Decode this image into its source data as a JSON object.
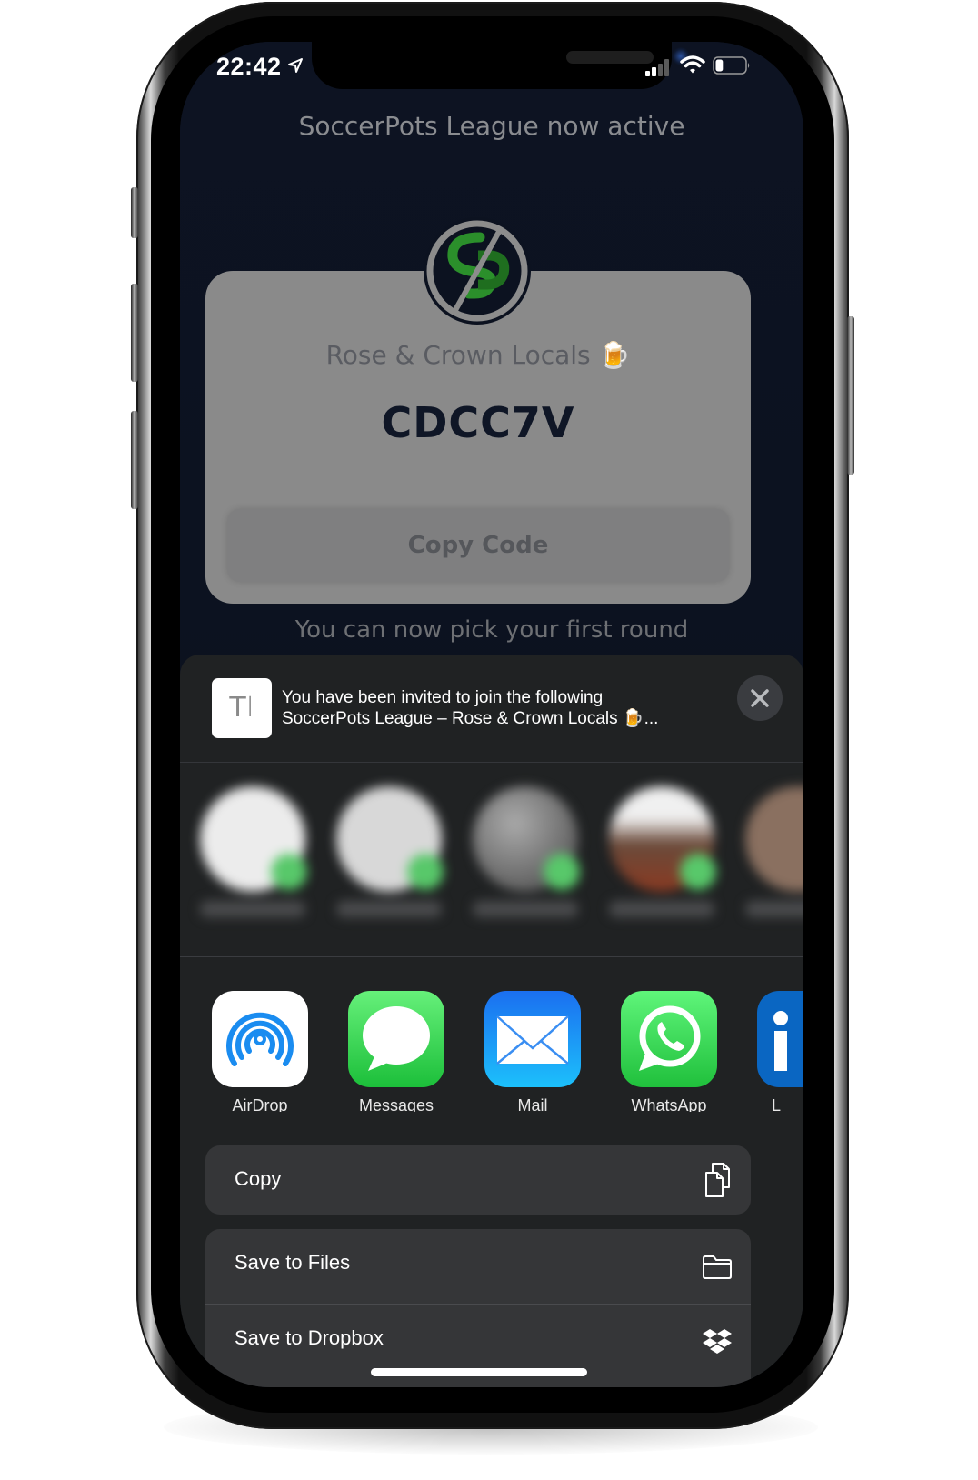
{
  "status_bar": {
    "time": "22:42",
    "signal_bars": 2,
    "signal_total": 4,
    "battery_level": 0.25
  },
  "app": {
    "title": "SoccerPots League now active",
    "league_name": "Rose & Crown Locals 🍺",
    "league_code": "CDCC7V",
    "copy_code_label": "Copy Code",
    "subtext": "You can now pick your first round",
    "logo_letters": "SP",
    "accent_color": "#2e9e2e"
  },
  "share_sheet": {
    "preview_line1": "You have been invited to join the following",
    "preview_line2": "SoccerPots League – Rose & Crown Locals 🍺...",
    "thumb_glyph": "T𝙸",
    "contacts": [
      {
        "name": "blurred",
        "avatar_color": "#e9e9e9"
      },
      {
        "name": "blurred",
        "avatar_color": "#d6d6d6"
      },
      {
        "name": "blurred",
        "avatar_color": "#6a6a6a"
      },
      {
        "name": "blurred",
        "avatar_color": "#7a5a44"
      },
      {
        "name": "blurred",
        "avatar_color": "#8a7060"
      }
    ],
    "apps": [
      {
        "label": "AirDrop",
        "icon": "airdrop-icon"
      },
      {
        "label": "Messages",
        "icon": "messages-icon"
      },
      {
        "label": "Mail",
        "icon": "mail-icon"
      },
      {
        "label": "WhatsApp",
        "icon": "whatsapp-icon"
      },
      {
        "label": "L",
        "icon": "linkedin-icon"
      }
    ],
    "actions": [
      {
        "label": "Copy",
        "icon": "copy-icon"
      },
      {
        "label": "Save to Files",
        "icon": "folder-icon"
      },
      {
        "label": "Save to Dropbox",
        "icon": "dropbox-icon"
      }
    ]
  }
}
